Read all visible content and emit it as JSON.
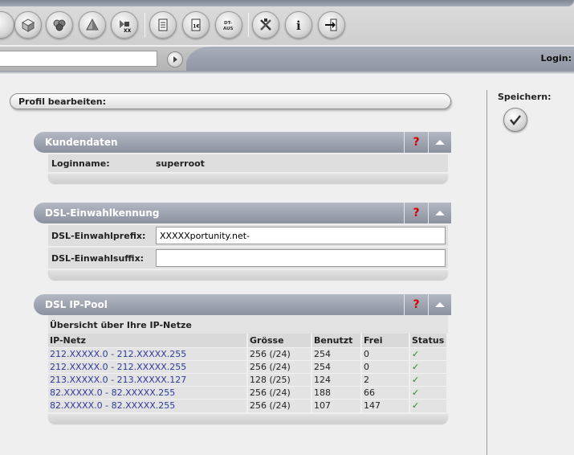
{
  "toolbar": {
    "buttons": [
      {
        "icon": "cube-icon"
      },
      {
        "icon": "cubes-icon"
      },
      {
        "icon": "pyramid-icon"
      },
      {
        "icon": "xx-shapes-icon"
      },
      {
        "icon": "document-icon"
      },
      {
        "icon": "euro-document-icon",
        "label": "1€"
      },
      {
        "icon": "dt-aus-icon",
        "label": "DT-\nAUS"
      },
      {
        "icon": "tools-icon"
      },
      {
        "icon": "info-icon",
        "label": "i"
      },
      {
        "icon": "exit-icon"
      }
    ]
  },
  "address": {
    "value": "",
    "login_label": "Login:"
  },
  "profile": {
    "title": "Profil bearbeiten:"
  },
  "save": {
    "label": "Speichern:"
  },
  "sections": {
    "kunden": {
      "title": "Kundendaten",
      "help": "?",
      "login_label": "Loginname:",
      "login_value": "superroot"
    },
    "dsl": {
      "title": "DSL-Einwahlkennung",
      "help": "?",
      "prefix_label": "DSL-Einwahlprefix:",
      "prefix_value": "XXXXXportunity.net-",
      "suffix_label": "DSL-Einwahlsuffix:",
      "suffix_value": ""
    },
    "pool": {
      "title": "DSL IP-Pool",
      "help": "?",
      "caption": "Übersicht über Ihre IP-Netze",
      "headers": [
        "IP-Netz",
        "Grösse",
        "Benutzt",
        "Frei",
        "Status"
      ],
      "rows": [
        [
          "212.XXXXX.0 - 212.XXXXX.255",
          "256 (/24)",
          "254",
          "0",
          "✓"
        ],
        [
          "212.XXXXX.0 - 212.XXXXX.255",
          "256 (/24)",
          "254",
          "0",
          "✓"
        ],
        [
          "213.XXXXX.0 - 213.XXXXX.127",
          "128 (/25)",
          "124",
          "2",
          "✓"
        ],
        [
          "82.XXXXX.0 - 82.XXXXX.255",
          "256 (/24)",
          "188",
          "66",
          "✓"
        ],
        [
          "82.XXXXX.0 - 82.XXXXX.255",
          "256 (/24)",
          "107",
          "147",
          "✓"
        ]
      ]
    }
  },
  "colors": {
    "accent_check": "#1a8a1a",
    "help": "#d40000",
    "link": "#2d3b9a",
    "section_header": "#8b919f"
  }
}
